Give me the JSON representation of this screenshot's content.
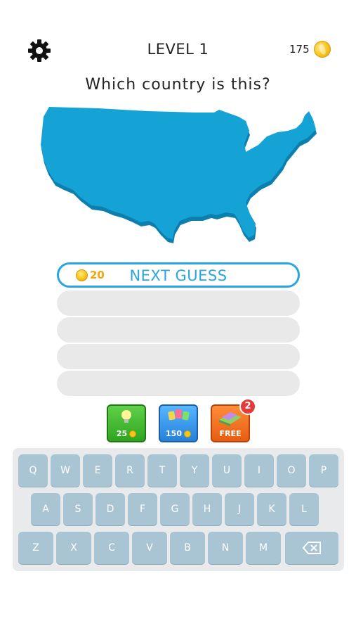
{
  "header": {
    "level": "LEVEL 1",
    "coins": "175",
    "settings_icon": "gear-icon",
    "coin_icon": "coin-icon"
  },
  "question": "Which country is this?",
  "map": {
    "shape": "united-states-outline",
    "color": "#15a3d6"
  },
  "guess": {
    "next_label": "NEXT GUESS",
    "next_cost": "20",
    "empty_rows": 4
  },
  "powerups": {
    "hint_cost": "25",
    "letters_cost": "150",
    "free_label": "FREE",
    "free_badge": "2"
  },
  "keyboard": {
    "row1": [
      "Q",
      "W",
      "E",
      "R",
      "T",
      "Y",
      "U",
      "I",
      "O",
      "P"
    ],
    "row2": [
      "A",
      "S",
      "D",
      "F",
      "G",
      "H",
      "J",
      "K",
      "L"
    ],
    "row3": [
      "Z",
      "X",
      "C",
      "V",
      "B",
      "N",
      "M"
    ],
    "backspace_icon": "backspace-icon"
  },
  "colors": {
    "accent": "#29a6df",
    "coin": "#f8c51c",
    "key": "#a9c5d3"
  }
}
